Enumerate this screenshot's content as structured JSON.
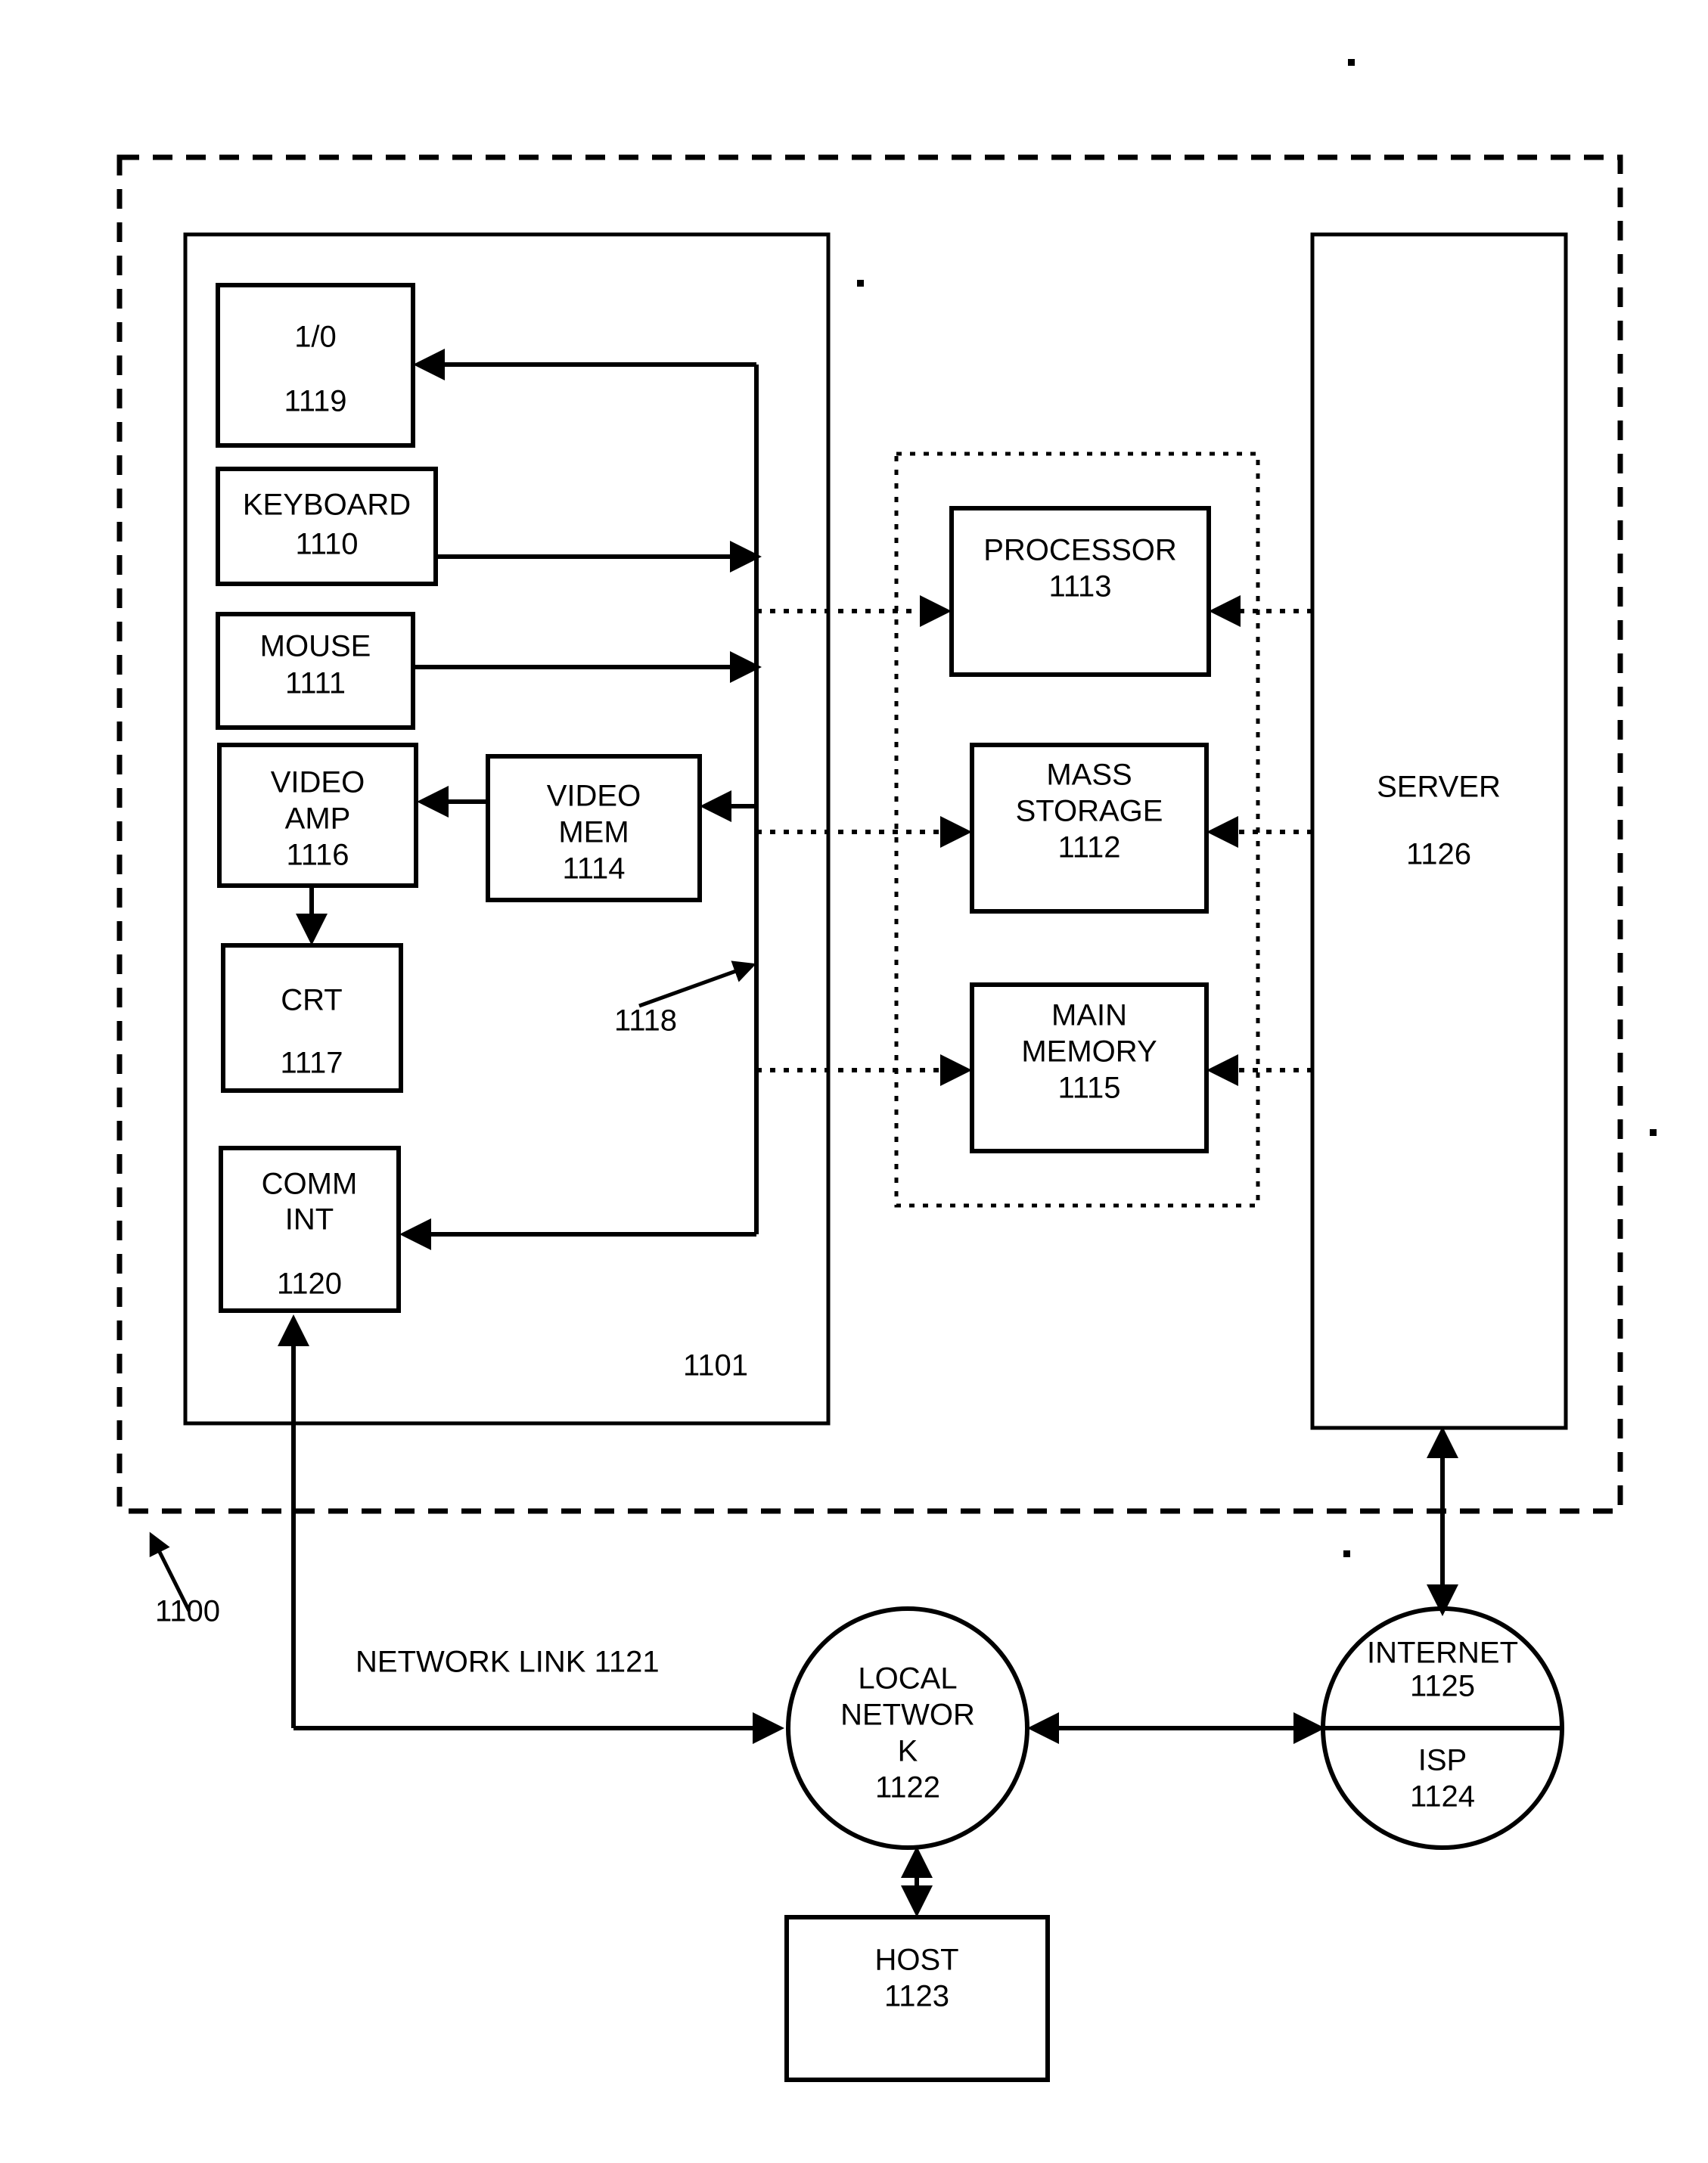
{
  "figure": {
    "system_ref": "1100",
    "computer_ref": "1101",
    "bus_ref": "1118",
    "network_link_label": "NETWORK LINK 1121"
  },
  "blocks": {
    "io": {
      "title": "1/0",
      "ref": "1119"
    },
    "keyboard": {
      "title": "KEYBOARD",
      "ref": "1110"
    },
    "mouse": {
      "title": "MOUSE",
      "ref": "1111"
    },
    "video_amp": {
      "title_line1": "VIDEO",
      "title_line2": "AMP",
      "ref": "1116"
    },
    "video_mem": {
      "title_line1": "VIDEO",
      "title_line2": "MEM",
      "ref": "1114"
    },
    "crt": {
      "title": "CRT",
      "ref": "1117"
    },
    "comm_int": {
      "title_line1": "COMM",
      "title_line2": "INT",
      "ref": "1120"
    },
    "processor": {
      "title": "PROCESSOR",
      "ref": "1113"
    },
    "mass_storage": {
      "title_line1": "MASS",
      "title_line2": "STORAGE",
      "ref": "1112"
    },
    "main_memory": {
      "title_line1": "MAIN",
      "title_line2": "MEMORY",
      "ref": "1115"
    },
    "server": {
      "title": "SERVER",
      "ref": "1126"
    },
    "host": {
      "title": "HOST",
      "ref": "1123"
    }
  },
  "nodes": {
    "local_network": {
      "title_line1": "LOCAL",
      "title_line2": "NETWOR",
      "title_line3": "K",
      "ref": "1122"
    },
    "internet": {
      "title": "INTERNET",
      "ref": "1125"
    },
    "isp": {
      "title": "ISP",
      "ref": "1124"
    }
  },
  "colors": {
    "stroke": "#000000",
    "background": "#ffffff"
  }
}
